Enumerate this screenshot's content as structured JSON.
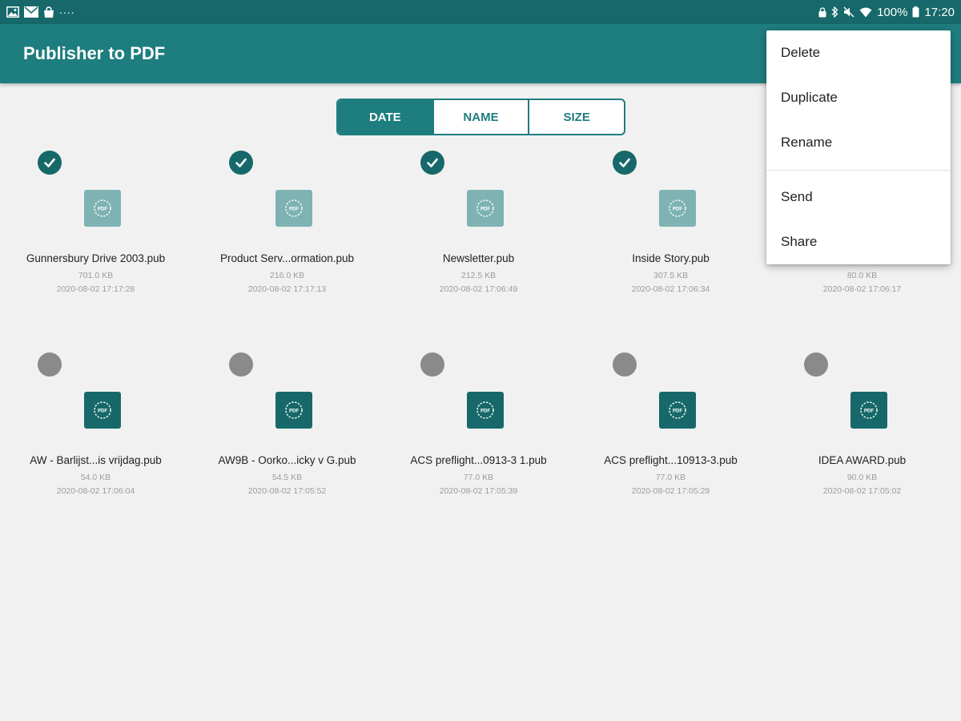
{
  "status_bar": {
    "left_icons": [
      "image-icon",
      "mail-icon",
      "shopping-bag-icon"
    ],
    "more_indicator": "....",
    "battery_text": "100%",
    "time": "17:20"
  },
  "app": {
    "title": "Publisher to PDF"
  },
  "sort": {
    "options": [
      "DATE",
      "NAME",
      "SIZE"
    ],
    "active": "DATE"
  },
  "files": [
    {
      "name": "Gunnersbury Drive 2003.pub",
      "size": "701.0 KB",
      "date": "2020-08-02 17:17:28",
      "selected": true
    },
    {
      "name": "Product Serv...ormation.pub",
      "size": "216.0 KB",
      "date": "2020-08-02 17:17:13",
      "selected": true
    },
    {
      "name": "Newsletter.pub",
      "size": "212.5 KB",
      "date": "2020-08-02 17:06:49",
      "selected": true
    },
    {
      "name": "Inside Story.pub",
      "size": "307.5 KB",
      "date": "2020-08-02 17:06:34",
      "selected": true
    },
    {
      "name": "",
      "size": "80.0 KB",
      "date": "2020-08-02 17:06:17",
      "selected": true
    },
    {
      "name": "AW - Barlijst...is vrijdag.pub",
      "size": "54.0 KB",
      "date": "2020-08-02 17:06:04",
      "selected": false
    },
    {
      "name": "AW9B - Oorko...icky v G.pub",
      "size": "54.5 KB",
      "date": "2020-08-02 17:05:52",
      "selected": false
    },
    {
      "name": "ACS preflight...0913-3 1.pub",
      "size": "77.0 KB",
      "date": "2020-08-02 17:05:39",
      "selected": false
    },
    {
      "name": "ACS preflight...10913-3.pub",
      "size": "77.0 KB",
      "date": "2020-08-02 17:05:29",
      "selected": false
    },
    {
      "name": "IDEA AWARD.pub",
      "size": "90.0 KB",
      "date": "2020-08-02 17:05:02",
      "selected": false
    }
  ],
  "menu": {
    "items": [
      "Delete",
      "Duplicate",
      "Rename",
      "Send",
      "Share"
    ]
  },
  "colors": {
    "status_bar": "#17686a",
    "app_bar": "#1e7d7f",
    "accent": "#1e7d7f",
    "thumb_selected": "#7fb2b2",
    "thumb_unselected": "#17686a",
    "radio_unselected": "#8a8a8a"
  }
}
